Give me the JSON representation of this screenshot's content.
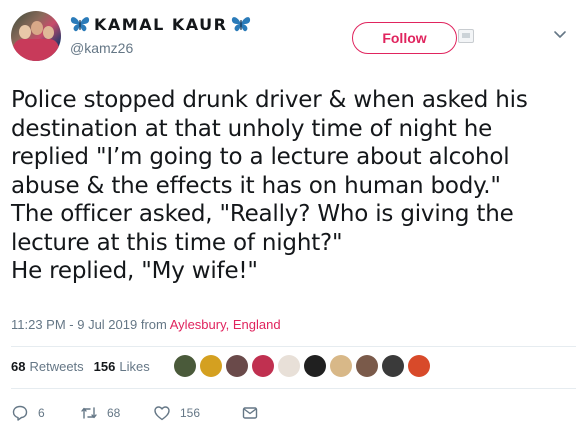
{
  "user": {
    "display_name": "KAMAL KAUR",
    "handle": "@kamz26",
    "name_emoji": "butterfly-icon"
  },
  "follow_button": {
    "label": "Follow"
  },
  "tweet": {
    "text": "Police stopped drunk driver & when asked his\ndestination at that unholy time of night he\nreplied \"I’m going to a lecture about alcohol\nabuse & the effects it has on human body.\"\nThe officer asked, \"Really? Who is giving the\nlecture at this time of night?\"\nHe replied, \"My wife!\"",
    "timestamp": "11:23 PM - 9 Jul 2019 from",
    "location": "Aylesbury, England"
  },
  "stats": {
    "retweets_count": "68",
    "retweets_label": "Retweets",
    "likes_count": "156",
    "likes_label": "Likes"
  },
  "likers": [
    {
      "name": "liker-avatar-1",
      "color": "#4a5a3a"
    },
    {
      "name": "liker-avatar-2",
      "color": "#d4a020"
    },
    {
      "name": "liker-avatar-3",
      "color": "#6a4a4a"
    },
    {
      "name": "liker-avatar-4",
      "color": "#c03050"
    },
    {
      "name": "liker-avatar-5",
      "color": "#e8e0d8"
    },
    {
      "name": "liker-avatar-6",
      "color": "#202020"
    },
    {
      "name": "liker-avatar-7",
      "color": "#d8b888"
    },
    {
      "name": "liker-avatar-8",
      "color": "#7a5a4a"
    },
    {
      "name": "liker-avatar-9",
      "color": "#3a3a3a"
    },
    {
      "name": "liker-avatar-10",
      "color": "#d84a2a"
    }
  ],
  "actions": {
    "reply_count": "6",
    "retweet_count": "68",
    "like_count": "156"
  },
  "colors": {
    "accent": "#e0245e",
    "secondary_text": "#657786",
    "divider": "#e6ecf0"
  }
}
